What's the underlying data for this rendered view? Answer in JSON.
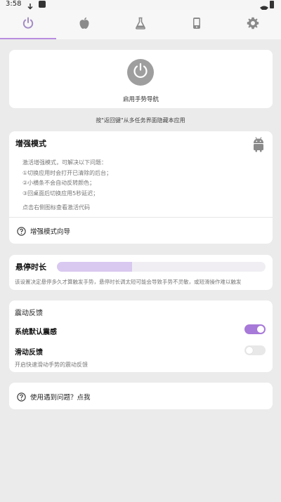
{
  "status_bar": {
    "time": "3:58",
    "icons": [
      "download-icon",
      "app-square-icon",
      "wifi-icon",
      "battery-icon"
    ]
  },
  "tabs": [
    {
      "icon": "power-icon",
      "selected": true
    },
    {
      "icon": "apple-icon",
      "selected": false
    },
    {
      "icon": "flask-icon",
      "selected": false
    },
    {
      "icon": "phone-icon",
      "selected": false
    },
    {
      "icon": "gear-icon",
      "selected": false
    }
  ],
  "gesture_card": {
    "icon": "power-icon",
    "label": "启用手势导航"
  },
  "hint": "按\"返回键\"从多任务界面隐藏本应用",
  "enhanced_card": {
    "title": "增强模式",
    "icon": "android-icon",
    "desc_lines": [
      "激活增强模式，可解决以下问题：",
      "①切换应用时会打开已清除的后台；",
      "②小横条不会自动反转颜色；",
      "③回桌面后切换应用5秒延迟；"
    ],
    "code_hint": "点击右侧图标查看激活代码",
    "guide_label": "增强模式向导"
  },
  "hover_card": {
    "title": "悬停时长",
    "slider_value_fraction": 0.36,
    "desc": "该设置决定悬停多久才算触发手势，悬停时长调太短可能会导致手势不灵敏，或短滑操作难以触发"
  },
  "vibration_card": {
    "title": "震动反馈",
    "system_default": {
      "label": "系统默认震感",
      "enabled": true
    },
    "swipe_feedback": {
      "label": "滑动反馈",
      "desc": "开启快速滑动手势的震动反馈",
      "enabled": false
    }
  },
  "help_card": {
    "label": "使用遇到问题？点我"
  },
  "colors": {
    "accent": "#a779d8",
    "tab_indicator": "#b88ee0",
    "slider_fill": "#d9c8f0",
    "background": "#ebebeb"
  }
}
